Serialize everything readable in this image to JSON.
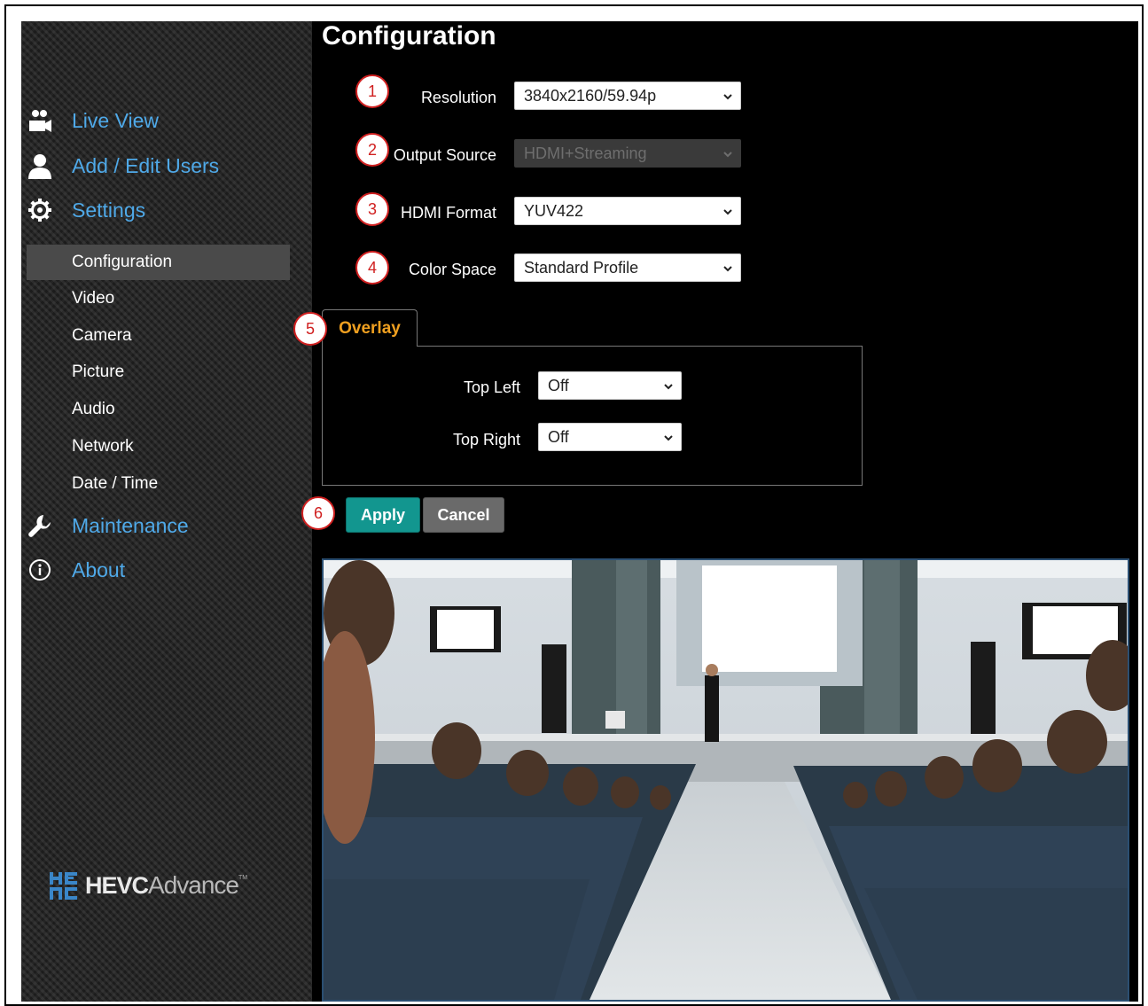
{
  "app": {
    "page_title": "Configuration"
  },
  "sidebar": {
    "main_items": [
      {
        "label": "Live View",
        "icon": "camera-users-icon"
      },
      {
        "label": "Add / Edit Users",
        "icon": "user-icon"
      },
      {
        "label": "Settings",
        "icon": "gear-icon"
      },
      {
        "label": "Maintenance",
        "icon": "wrench-icon"
      },
      {
        "label": "About",
        "icon": "info-icon"
      }
    ],
    "settings_items": [
      "Configuration",
      "Video",
      "Camera",
      "Picture",
      "Audio",
      "Network",
      "Date / Time"
    ],
    "active_item": "Configuration",
    "logo": {
      "part1": "HEVC",
      "part2": "Advance",
      "tm": "TM"
    }
  },
  "form": {
    "resolution": {
      "label": "Resolution",
      "value": "3840x2160/59.94p"
    },
    "output_source": {
      "label": "Output Source",
      "value": "HDMI+Streaming",
      "disabled": true
    },
    "hdmi_format": {
      "label": "HDMI Format",
      "value": "YUV422"
    },
    "color_space": {
      "label": "Color Space",
      "value": "Standard Profile"
    }
  },
  "overlay": {
    "tab_label": "Overlay",
    "top_left": {
      "label": "Top Left",
      "value": "Off"
    },
    "top_right": {
      "label": "Top Right",
      "value": "Off"
    }
  },
  "buttons": {
    "apply": "Apply",
    "cancel": "Cancel"
  },
  "callouts": [
    "1",
    "2",
    "3",
    "4",
    "5",
    "6"
  ],
  "colors": {
    "nav_accent": "#4fa9e8",
    "tab_accent": "#f0a020",
    "apply_bg": "#12968f",
    "callout": "#d02020"
  }
}
